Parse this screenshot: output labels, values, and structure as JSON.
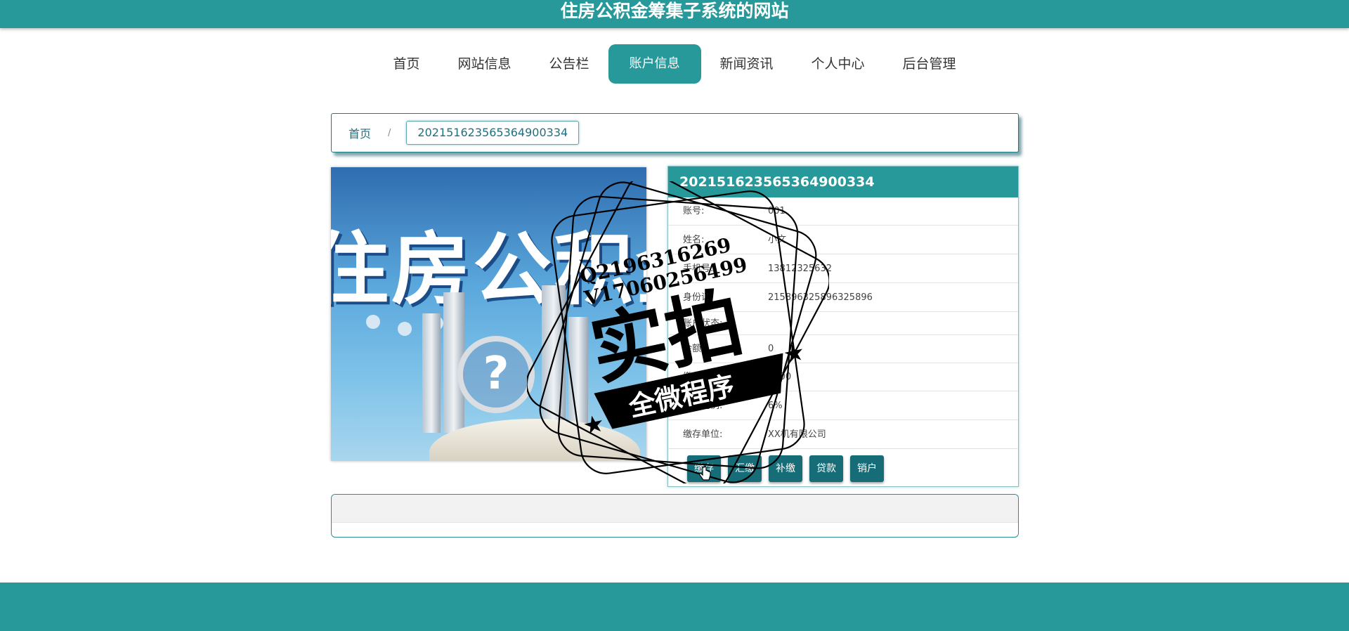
{
  "header": {
    "site_title": "住房公积金筹集子系统的网站"
  },
  "nav": {
    "items": [
      {
        "label": "首页",
        "active": false
      },
      {
        "label": "网站信息",
        "active": false
      },
      {
        "label": "公告栏",
        "active": false
      },
      {
        "label": "账户信息",
        "active": true
      },
      {
        "label": "新闻资讯",
        "active": false
      },
      {
        "label": "个人中心",
        "active": false
      },
      {
        "label": "后台管理",
        "active": false
      }
    ]
  },
  "breadcrumb": {
    "home": "首页",
    "separator": "/",
    "current": "202151623565364900334"
  },
  "detail": {
    "title": "202151623565364900334",
    "rows": [
      {
        "key": "账号:",
        "value": "001"
      },
      {
        "key": "姓名:",
        "value": "小文"
      },
      {
        "key": "手机号:",
        "value": "13812325632"
      },
      {
        "key": "身份证:",
        "value": "215896325896325896"
      },
      {
        "key": "账户状态:",
        "value": ""
      },
      {
        "key": "余额:",
        "value": "0"
      },
      {
        "key": "缴存基数:",
        "value": "4500"
      },
      {
        "key": "缴存比例:",
        "value": "6%"
      },
      {
        "key": "缴存单位:",
        "value": "XX机有限公司"
      }
    ],
    "buttons": [
      "缴存",
      "汇缴",
      "补缴",
      "贷款",
      "销户"
    ]
  },
  "photo": {
    "text": "住房公积金"
  },
  "watermark": {
    "line1": "Q2196316269",
    "line2": "V17060256499",
    "big": "实拍",
    "banner": "全微程序"
  },
  "colors": {
    "primary": "#27999b",
    "button": "#166d78",
    "footer": "#27999b"
  }
}
